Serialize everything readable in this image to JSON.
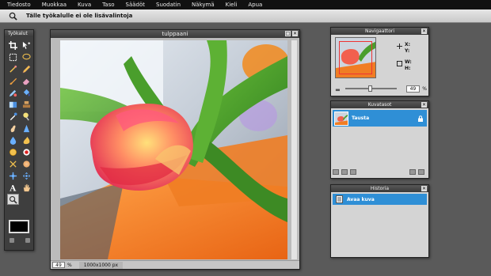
{
  "menu": [
    "Tiedosto",
    "Muokkaa",
    "Kuva",
    "Taso",
    "Säädöt",
    "Suodatin",
    "Näkymä",
    "Kieli",
    "Apua"
  ],
  "options_bar": {
    "message": "Tälle työkalulle ei ole lisävalintoja",
    "tool_icon": "magnifier-icon"
  },
  "toolbox": {
    "title": "Työkalut",
    "tools": [
      "crop-icon",
      "move-icon",
      "marquee-icon",
      "lasso-icon",
      "wand-icon",
      "pencil-icon",
      "brush-icon",
      "eraser-icon",
      "replace-color-icon",
      "bucket-icon",
      "gradient-icon",
      "stamp-icon",
      "picker-icon",
      "dodge-icon",
      "smudge-icon",
      "sharpen-icon",
      "blur-icon",
      "burn-icon",
      "drawing-icon",
      "red-eye-icon",
      "pinch-icon",
      "bloat-icon",
      "wrap-icon",
      "colorpicker-icon",
      "type-icon",
      "hand-icon",
      "zoom-icon"
    ],
    "active_tool": "zoom-icon",
    "primary_color": "#000000"
  },
  "document": {
    "title": "tulppaani",
    "zoom": "49",
    "zoom_unit": "%",
    "dimensions": "1000x1000 px"
  },
  "navigator": {
    "title": "Navigaattori",
    "x_label": "X:",
    "y_label": "Y:",
    "w_label": "W:",
    "h_label": "H:",
    "zoom": "49",
    "zoom_unit": "%",
    "zoom_fraction": 0.49
  },
  "layers": {
    "title": "Kuvatasot",
    "items": [
      {
        "name": "Tausta",
        "locked": true
      }
    ]
  },
  "history": {
    "title": "Historia",
    "items": [
      {
        "label": "Avaa kuva"
      }
    ]
  },
  "colors": {
    "selection": "#2f8fd6",
    "workspace": "#5a5a5a",
    "menubar": "#111111"
  }
}
